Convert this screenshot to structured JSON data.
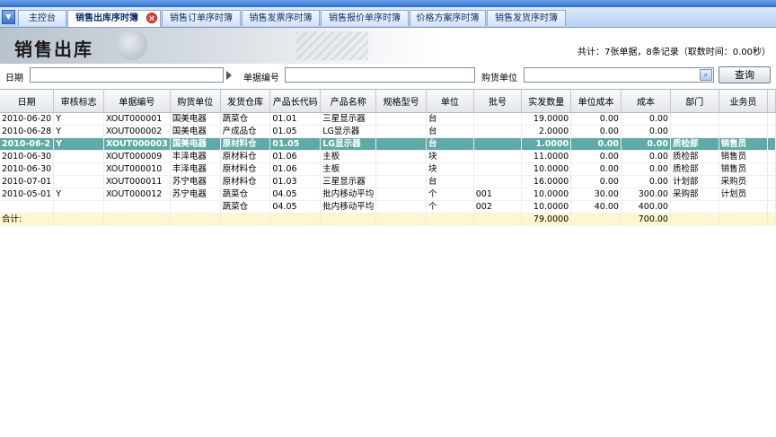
{
  "tabs": [
    {
      "label": "主控台",
      "active": false
    },
    {
      "label": "销售出库序时簿",
      "active": true
    },
    {
      "label": "销售订单序时簿",
      "active": false
    },
    {
      "label": "销售发票序时簿",
      "active": false
    },
    {
      "label": "销售报价单序时簿",
      "active": false
    },
    {
      "label": "价格方案序时簿",
      "active": false
    },
    {
      "label": "销售发货序时簿",
      "active": false
    }
  ],
  "tab_close_glyph": "×",
  "tab_menu_glyph": "▼",
  "header": {
    "title": "销售出库",
    "summary": "共计：7张单据，8条记录（取数时间：0.00秒）"
  },
  "filters": {
    "date_label": "日期",
    "date_value": "",
    "doc_no_label": "单据编号",
    "doc_no_value": "",
    "buyer_label": "购货单位",
    "buyer_value": "",
    "query_label": "查询"
  },
  "grid": {
    "columns": [
      "日期",
      "审核标志",
      "单据编号",
      "购货单位",
      "发货仓库",
      "产品长代码",
      "产品名称",
      "规格型号",
      "单位",
      "批号",
      "实发数量",
      "单位成本",
      "成本",
      "部门",
      "业务员",
      ""
    ],
    "rows": [
      {
        "cells": [
          "2010-06-20",
          "Y",
          "XOUT000001",
          "国美电器",
          "蔬菜仓",
          "01.01",
          "三星显示器",
          "",
          "台",
          "",
          "19.0000",
          "0.00",
          "0.00",
          "",
          ""
        ],
        "selected": false
      },
      {
        "cells": [
          "2010-06-28",
          "Y",
          "XOUT000002",
          "国美电器",
          "产成品仓",
          "01.05",
          "LG显示器",
          "",
          "台",
          "",
          "2.0000",
          "0.00",
          "0.00",
          "",
          ""
        ],
        "selected": false
      },
      {
        "cells": [
          "2010-06-2",
          "Y",
          "XOUT000003",
          "国美电器",
          "原材料仓",
          "01.05",
          "LG显示器",
          "",
          "台",
          "",
          "1.0000",
          "0.00",
          "0.00",
          "质检部",
          "销售员"
        ],
        "selected": true
      },
      {
        "cells": [
          "2010-06-30",
          "",
          "XOUT000009",
          "丰泽电器",
          "原材料仓",
          "01.06",
          "主板",
          "",
          "块",
          "",
          "11.0000",
          "0.00",
          "0.00",
          "质检部",
          "销售员"
        ],
        "selected": false
      },
      {
        "cells": [
          "2010-06-30",
          "",
          "XOUT000010",
          "丰泽电器",
          "原材料仓",
          "01.06",
          "主板",
          "",
          "块",
          "",
          "10.0000",
          "0.00",
          "0.00",
          "质检部",
          "销售员"
        ],
        "selected": false
      },
      {
        "cells": [
          "2010-07-01",
          "",
          "XOUT000011",
          "苏宁电器",
          "原材料仓",
          "01.03",
          "三星显示器",
          "",
          "台",
          "",
          "16.0000",
          "0.00",
          "0.00",
          "计划部",
          "采购员"
        ],
        "selected": false
      },
      {
        "cells": [
          "2010-05-01",
          "Y",
          "XOUT000012",
          "苏宁电器",
          "蔬菜仓",
          "04.05",
          "批内移动平均",
          "",
          "个",
          "001",
          "10.0000",
          "30.00",
          "300.00",
          "采购部",
          "计划员"
        ],
        "selected": false
      },
      {
        "cells": [
          "",
          "",
          "",
          "",
          "蔬菜仓",
          "04.05",
          "批内移动平均",
          "",
          "个",
          "002",
          "10.0000",
          "40.00",
          "400.00",
          "",
          ""
        ],
        "selected": false
      }
    ],
    "total": {
      "label": "合计:",
      "qty": "79.0000",
      "cost": "700.00"
    }
  }
}
